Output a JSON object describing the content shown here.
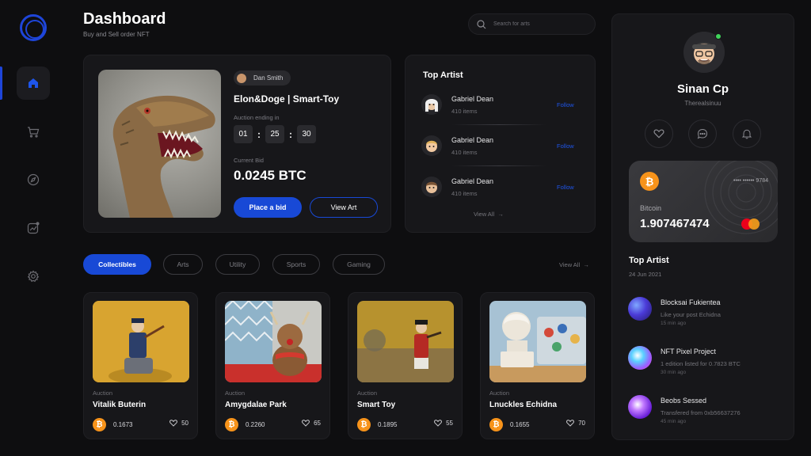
{
  "header": {
    "title": "Dashboard",
    "subtitle": "Buy and Sell order NFT"
  },
  "search": {
    "placeholder": "Search for arts"
  },
  "sidebar": {
    "logo": "logo-ring-icon",
    "items": [
      {
        "icon": "home-icon",
        "active": true
      },
      {
        "icon": "cart-icon",
        "active": false
      },
      {
        "icon": "compass-icon",
        "active": false
      },
      {
        "icon": "analytics-icon",
        "active": false
      },
      {
        "icon": "gear-icon",
        "active": false
      }
    ]
  },
  "featured": {
    "owner": "Dan Smith",
    "name": "Elon&Doge | Smart-Toy",
    "auction_label": "Auction ending in",
    "timer": {
      "hours": "01",
      "minutes": "25",
      "seconds": "30"
    },
    "bid_label": "Current Bid",
    "bid_value": "0.0245 BTC",
    "place_bid": "Place a bid",
    "view_art": "View Art"
  },
  "top_artists": {
    "title": "Top Artist",
    "artists": [
      {
        "name": "Gabriel Dean",
        "items": "410 items",
        "action": "Follow"
      },
      {
        "name": "Gabriel Dean",
        "items": "410 items",
        "action": "Follow"
      },
      {
        "name": "Gabriel Dean",
        "items": "410 items",
        "action": "Follow"
      }
    ],
    "view_all": "View All"
  },
  "tabs": [
    "Collectibles",
    "Arts",
    "Utility",
    "Sports",
    "Gaming"
  ],
  "tabs_view_all": "View All",
  "nfts": [
    {
      "status": "Auction",
      "name": "Vitalik Buterin",
      "price": "0.1673",
      "likes": "50"
    },
    {
      "status": "Auction",
      "name": "Amygdalae Park",
      "price": "0.2260",
      "likes": "65"
    },
    {
      "status": "Auction",
      "name": "Smart Toy",
      "price": "0.1895",
      "likes": "55"
    },
    {
      "status": "Auction",
      "name": "Lnuckles Echidna",
      "price": "0.1655",
      "likes": "70"
    }
  ],
  "profile": {
    "name": "Sinan Cp",
    "handle": "Therealsinuu",
    "wallet": {
      "card_number": "•••• •••••• 9784",
      "currency": "Bitcoin",
      "balance": "1.907467474"
    },
    "activity_title": "Top Artist",
    "activity_date": "24 Jun 2021",
    "activities": [
      {
        "title": "Blocksai Fukientea",
        "desc": "Like your post Echidna",
        "time": "15 min ago"
      },
      {
        "title": "NFT Pixel Project",
        "desc": "1 edition listed for 0.7823 BTC",
        "time": "30 min ago"
      },
      {
        "title": "Beobs Sessed",
        "desc": "Transfered from 0xb56637276",
        "time": "45 min ago"
      }
    ]
  },
  "colors": {
    "accent": "#1849d6",
    "bitcoin": "#f7931a",
    "online": "#3fd45a",
    "link": "#1e55ea"
  }
}
